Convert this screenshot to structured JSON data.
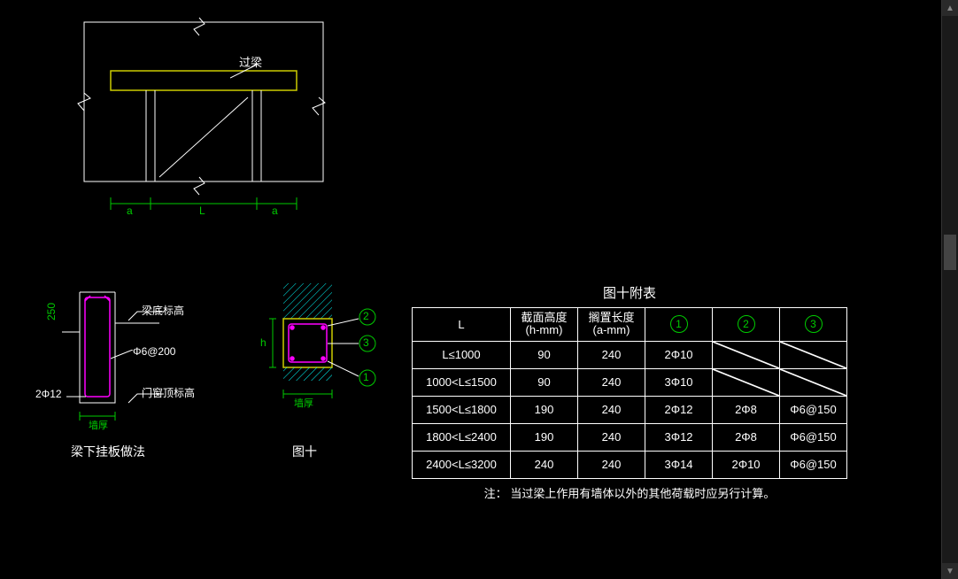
{
  "top": {
    "label_lintel": "过梁",
    "dim_a_left": "a",
    "dim_L": "L",
    "dim_a_right": "a"
  },
  "section_left": {
    "dim_250": "250",
    "label_top": "梁底标高",
    "label_stirrup": "Φ6@200",
    "label_bar": "2Φ12",
    "label_bottom": "门窗顶标高",
    "dim_wall": "墙厚",
    "title": "梁下挂板做法"
  },
  "section_right": {
    "dim_h": "h",
    "dim_wall": "墙厚",
    "title": "图十",
    "callout1": "1",
    "callout2": "2",
    "callout3": "3"
  },
  "table": {
    "title": "图十附表",
    "headers": {
      "L": "L",
      "h": "截面高度\n(h-mm)",
      "a": "搁置长度\n(a-mm)",
      "c1": "1",
      "c2": "2",
      "c3": "3"
    },
    "rows": [
      {
        "L": "L≤1000",
        "h": "90",
        "a": "240",
        "c1": "2Φ10",
        "c2": "",
        "c3": ""
      },
      {
        "L": "1000<L≤1500",
        "h": "90",
        "a": "240",
        "c1": "3Φ10",
        "c2": "",
        "c3": ""
      },
      {
        "L": "1500<L≤1800",
        "h": "190",
        "a": "240",
        "c1": "2Φ12",
        "c2": "2Φ8",
        "c3": "Φ6@150"
      },
      {
        "L": "1800<L≤2400",
        "h": "190",
        "a": "240",
        "c1": "3Φ12",
        "c2": "2Φ8",
        "c3": "Φ6@150"
      },
      {
        "L": "2400<L≤3200",
        "h": "240",
        "a": "240",
        "c1": "3Φ14",
        "c2": "2Φ10",
        "c3": "Φ6@150"
      }
    ],
    "note_label": "注：",
    "note": "当过梁上作用有墙体以外的其他荷载时应另行计算。"
  }
}
